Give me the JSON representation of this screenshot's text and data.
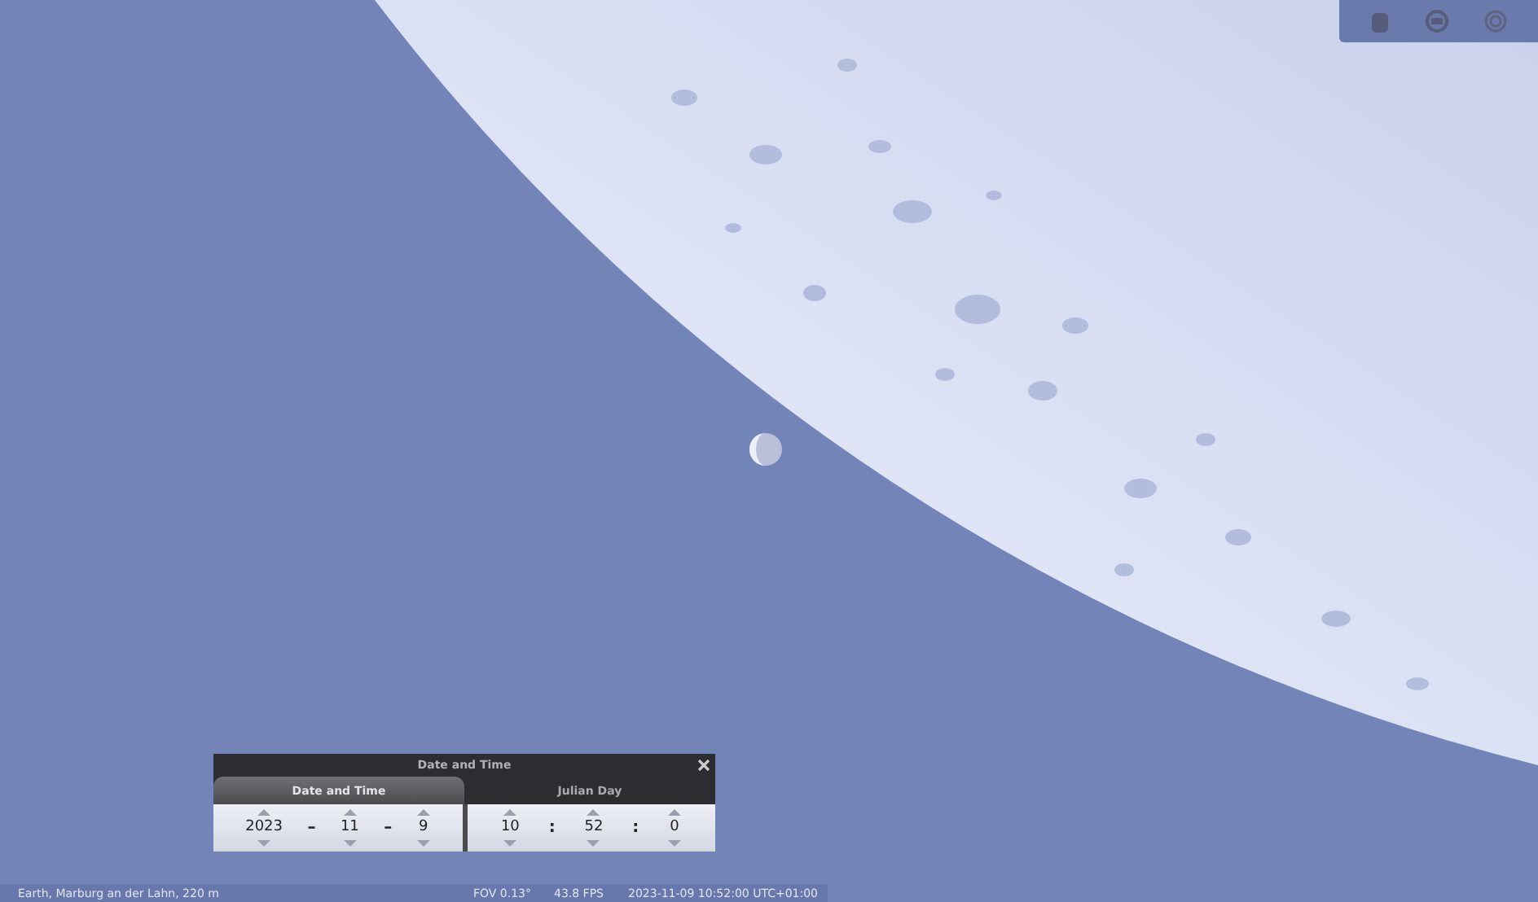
{
  "dialog": {
    "title": "Date and Time",
    "tabs": [
      {
        "label": "Date and Time",
        "selected": true
      },
      {
        "label": "Julian Day",
        "selected": false
      }
    ],
    "date_parts": [
      {
        "kind": "field",
        "value": "2023"
      },
      {
        "kind": "separator",
        "value": "–"
      },
      {
        "kind": "field",
        "value": "11"
      },
      {
        "kind": "separator",
        "value": "–"
      },
      {
        "kind": "field",
        "value": "9"
      }
    ],
    "time_parts": [
      {
        "kind": "field",
        "value": "10"
      },
      {
        "kind": "separator",
        "value": ":"
      },
      {
        "kind": "field",
        "value": "52"
      },
      {
        "kind": "separator",
        "value": ":"
      },
      {
        "kind": "field",
        "value": "0"
      }
    ]
  },
  "status_bar": {
    "location": "Earth, Marburg an der Lahn, 220 m",
    "fov": "FOV 0.13°",
    "fps": "43.8 FPS",
    "datetime": "2023-11-09 10:52:00 UTC+01:00"
  }
}
